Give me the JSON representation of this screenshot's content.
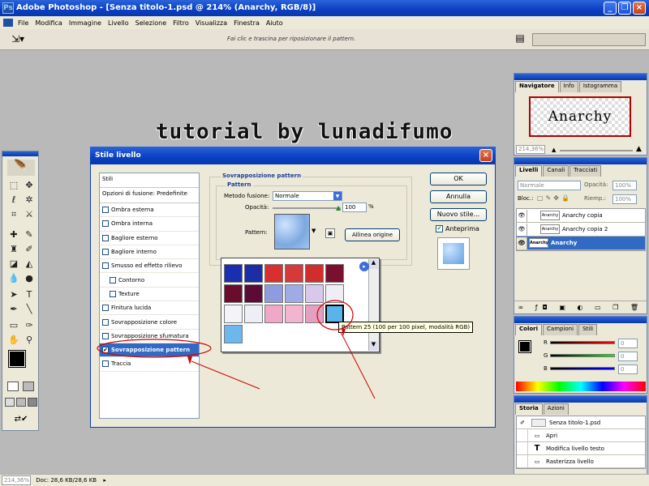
{
  "app": {
    "title": "Adobe Photoshop - [Senza titolo-1.psd @ 214% (Anarchy, RGB/8)]"
  },
  "menu": [
    "File",
    "Modifica",
    "Immagine",
    "Livello",
    "Selezione",
    "Filtro",
    "Visualizza",
    "Finestra",
    "Aiuto"
  ],
  "options": {
    "hint": "Fai clic e trascina per riposizionare il pattern."
  },
  "canvas": {
    "watermark": "tutorial by lunadifumo"
  },
  "dialog": {
    "title": "Stile livello",
    "styles_header": "Stili",
    "blend_options": "Opzioni di fusione: Predefinite",
    "effects": [
      {
        "label": "Ombra esterna",
        "checked": false
      },
      {
        "label": "Ombra interna",
        "checked": false
      },
      {
        "label": "Bagliore esterno",
        "checked": false
      },
      {
        "label": "Bagliore interno",
        "checked": false
      },
      {
        "label": "Smusso ed effetto rilievo",
        "checked": false
      },
      {
        "label": "Contorno",
        "checked": false
      },
      {
        "label": "Texture",
        "checked": false
      },
      {
        "label": "Finitura lucida",
        "checked": false
      },
      {
        "label": "Sovrapposizione colore",
        "checked": false
      },
      {
        "label": "Sovrapposizione sfumatura",
        "checked": false
      },
      {
        "label": "Sovrapposizione pattern",
        "checked": true
      },
      {
        "label": "Traccia",
        "checked": false
      }
    ],
    "group_title": "Sovrapposizione pattern",
    "subgroup_title": "Pattern",
    "blend_mode_label": "Metodo fusione:",
    "blend_mode_value": "Normale",
    "opacity_label": "Opacità:",
    "opacity_value": "100",
    "opacity_unit": "%",
    "pattern_label": "Pattern:",
    "align_button": "Allinea origine",
    "ok": "OK",
    "cancel": "Annulla",
    "new_style": "Nuovo stile...",
    "preview_label": "Anteprima",
    "preview_checked": true,
    "tooltip": "Pattern 25 (100 per 100 pixel, modalità RGB)"
  },
  "navigator": {
    "tabs": [
      "Navigatore",
      "Info",
      "Istogramma"
    ],
    "preview_text": "Anarchy",
    "zoom": "214,36%"
  },
  "layers": {
    "tabs": [
      "Livelli",
      "Canali",
      "Tracciati"
    ],
    "blend": "Normale",
    "opacity_label": "Opacità:",
    "opacity": "100%",
    "lock_label": "Bloc.:",
    "fill_label": "Riemp.:",
    "fill": "100%",
    "items": [
      {
        "name": "Anarchy copia",
        "selected": false
      },
      {
        "name": "Anarchy copia 2",
        "selected": false
      },
      {
        "name": "Anarchy",
        "selected": true
      }
    ]
  },
  "color": {
    "tabs": [
      "Colori",
      "Campioni",
      "Stili"
    ],
    "channels": [
      {
        "label": "R",
        "value": "0"
      },
      {
        "label": "G",
        "value": "0"
      },
      {
        "label": "B",
        "value": "0"
      }
    ]
  },
  "history": {
    "tabs": [
      "Storia",
      "Azioni"
    ],
    "snapshot": "Senza titolo-1.psd",
    "items": [
      "Apri",
      "Modifica livello testo",
      "Rasterizza livello"
    ]
  },
  "status": {
    "zoom": "214,36%",
    "doc": "Doc: 28,6 KB/28,6 KB"
  },
  "colors": {
    "accent": "#316ac5",
    "titlebar": "#0a3fc2",
    "annotation": "#d40000"
  }
}
